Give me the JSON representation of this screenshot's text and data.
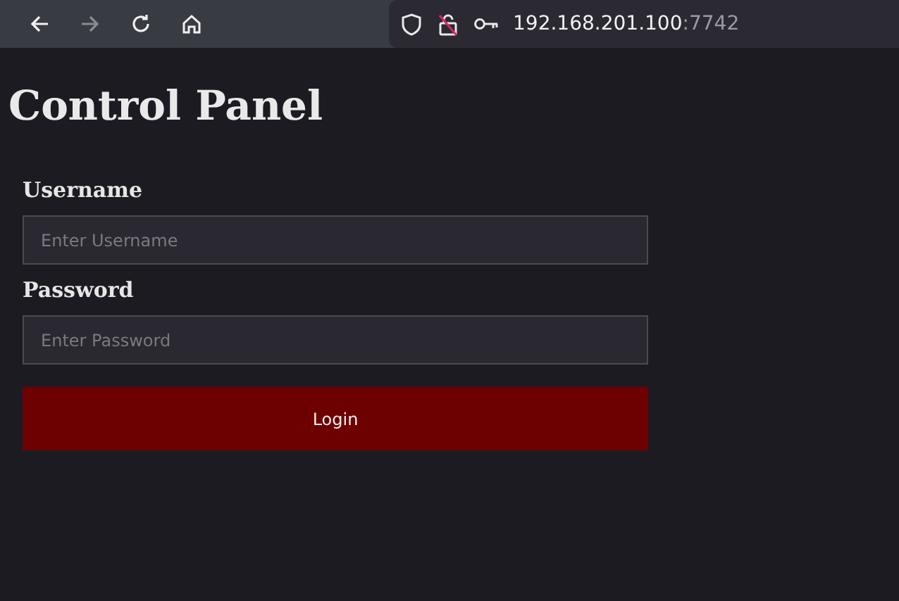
{
  "browser": {
    "nav_buttons": [
      {
        "kind": "back",
        "disabled": false
      },
      {
        "kind": "forward",
        "disabled": true
      },
      {
        "kind": "reload",
        "disabled": false
      },
      {
        "kind": "home",
        "disabled": false
      }
    ],
    "address": {
      "host": "192.168.201.100",
      "port": ":7742"
    }
  },
  "page": {
    "title": "Control Panel",
    "fields": [
      {
        "label": "Username",
        "placeholder": "Enter Username"
      },
      {
        "label": "Password",
        "placeholder": "Enter Password"
      }
    ],
    "button": "Login"
  }
}
